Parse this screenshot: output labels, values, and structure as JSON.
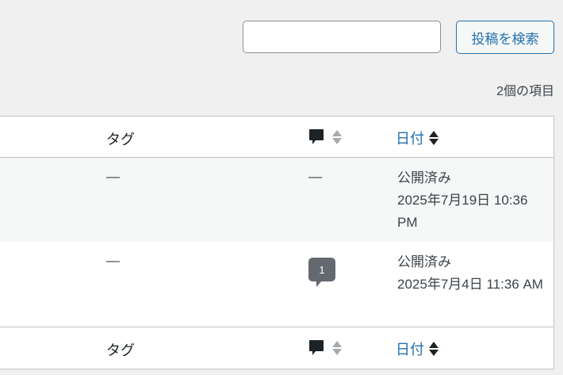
{
  "search": {
    "value": "",
    "placeholder": "",
    "button_label": "投稿を検索"
  },
  "item_count": "2個の項目",
  "table": {
    "columns": {
      "tags": "タグ",
      "comments_icon": "comment-icon",
      "date": "日付"
    },
    "rows": [
      {
        "tags": "—",
        "comments": "—",
        "status": "公開済み",
        "date": "2025年7月19日 10:36 PM"
      },
      {
        "tags": "—",
        "comments": "1",
        "status": "公開済み",
        "date": "2025年7月4日 11:36 AM"
      }
    ]
  },
  "colors": {
    "link": "#2271b1",
    "border": "#c3c4c7",
    "comment_bubble": "#646970"
  }
}
